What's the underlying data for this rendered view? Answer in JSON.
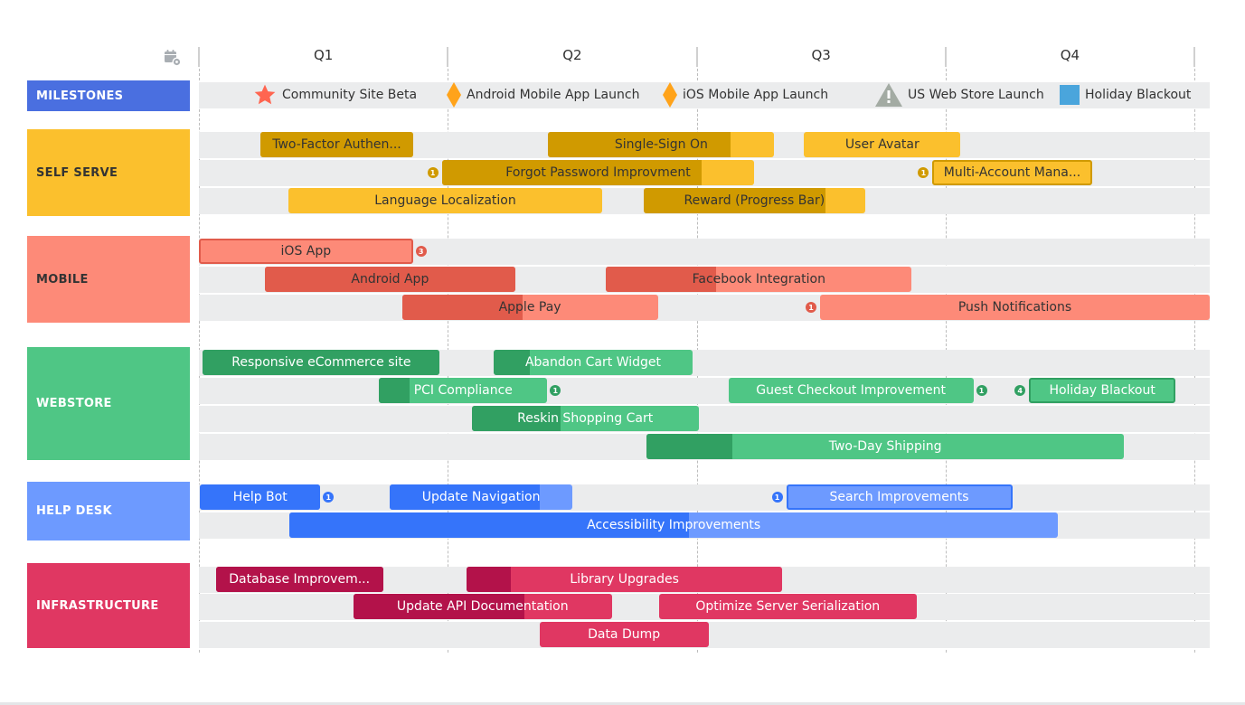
{
  "header": {
    "settings_icon": "calendar-gear-icon",
    "quarters": [
      "Q1",
      "Q2",
      "Q3",
      "Q4"
    ]
  },
  "milestones": {
    "label": "MILESTONES",
    "color": "#4a6fe0",
    "items": [
      {
        "name": "Community Site Beta",
        "icon": "star-icon",
        "color": "#ff6550",
        "position": 0.066
      },
      {
        "name": "Android Mobile App Launch",
        "icon": "diamond-icon",
        "color": "#ffa31a",
        "position": 0.25
      },
      {
        "name": "iOS Mobile App Launch",
        "icon": "diamond-icon",
        "color": "#ffa31a",
        "position": 0.477
      },
      {
        "name": "US Web Store Launch",
        "icon": "warning-icon",
        "color": "#a3aba3",
        "position": 0.68
      },
      {
        "name": "Holiday Blackout",
        "icon": "square-icon",
        "color": "#4aa5dc",
        "position": 0.864
      }
    ]
  },
  "lanes": [
    {
      "label": "SELF SERVE",
      "color": "#fbc02d",
      "dark": "#d09a00",
      "text": "#333333",
      "label_text": "#333333",
      "rows": [
        [
          {
            "name": "Two-Factor Authen...",
            "start": 0.062,
            "end": 0.215,
            "progress": 1.0
          },
          {
            "name": "Single-Sign On",
            "start": 0.351,
            "end": 0.578,
            "progress": 0.807
          },
          {
            "name": "User Avatar",
            "start": 0.608,
            "end": 0.765,
            "progress": 0.0
          }
        ],
        [
          {
            "name": "Forgot Password Improvment",
            "start": 0.244,
            "end": 0.558,
            "progress": 0.83,
            "badge_before": "1"
          },
          {
            "name": "Multi-Account Mana...",
            "start": 0.737,
            "end": 0.897,
            "progress": 0.0,
            "badge_before": "1",
            "outlined": true
          }
        ],
        [
          {
            "name": "Language Localization",
            "start": 0.09,
            "end": 0.405,
            "progress": 0.0
          },
          {
            "name": "Reward (Progress Bar)",
            "start": 0.447,
            "end": 0.669,
            "progress": 0.82
          }
        ]
      ]
    },
    {
      "label": "MOBILE",
      "color": "#fd8a78",
      "dark": "#e15b4b",
      "text": "#333333",
      "label_text": "#333333",
      "rows": [
        [
          {
            "name": "iOS App",
            "start": 0.0,
            "end": 0.215,
            "progress": 0.0,
            "badge_after": "3",
            "outlined": true
          }
        ],
        [
          {
            "name": "Android App",
            "start": 0.066,
            "end": 0.318,
            "progress": 1.0
          },
          {
            "name": "Facebook Integration",
            "start": 0.409,
            "end": 0.716,
            "progress": 0.36
          }
        ],
        [
          {
            "name": "Apple Pay",
            "start": 0.204,
            "end": 0.461,
            "progress": 0.47
          },
          {
            "name": "Push Notifications",
            "start": 0.624,
            "end": 1.016,
            "progress": 0.0,
            "badge_before": "1"
          }
        ]
      ]
    },
    {
      "label": "WEBSTORE",
      "color": "#4fc685",
      "dark": "#31a062",
      "text": "#ffffff",
      "label_text": "#ffffff",
      "rows": [
        [
          {
            "name": "Responsive eCommerce site",
            "start": 0.004,
            "end": 0.242,
            "progress": 1.0
          },
          {
            "name": "Abandon Cart Widget",
            "start": 0.296,
            "end": 0.496,
            "progress": 0.18
          }
        ],
        [
          {
            "name": "PCI Compliance",
            "start": 0.181,
            "end": 0.35,
            "progress": 0.18,
            "badge_after": "1"
          },
          {
            "name": "Guest Checkout Improvement",
            "start": 0.532,
            "end": 0.778,
            "progress": 0.0,
            "badge_after": "1"
          },
          {
            "name": "Holiday Blackout",
            "start": 0.834,
            "end": 0.981,
            "progress": 0.0,
            "badge_before": "4",
            "outlined": true
          }
        ],
        [
          {
            "name": "Reskin Shopping Cart",
            "start": 0.274,
            "end": 0.502,
            "progress": 0.39
          }
        ],
        [
          {
            "name": "Two-Day Shipping",
            "start": 0.45,
            "end": 0.929,
            "progress": 0.18
          }
        ]
      ]
    },
    {
      "label": "HELP DESK",
      "color": "#6d9aff",
      "dark": "#3574fa",
      "text": "#ffffff",
      "label_text": "#ffffff",
      "rows": [
        [
          {
            "name": "Help Bot",
            "start": 0.001,
            "end": 0.122,
            "progress": 1.0,
            "badge_after": "1"
          },
          {
            "name": "Update Navigation",
            "start": 0.192,
            "end": 0.375,
            "progress": 0.82
          },
          {
            "name": "Search Improvements",
            "start": 0.59,
            "end": 0.817,
            "progress": 0.0,
            "badge_before": "1",
            "outlined": true
          }
        ],
        [
          {
            "name": "Accessibility Improvements",
            "start": 0.091,
            "end": 0.863,
            "progress": 0.52
          }
        ]
      ]
    },
    {
      "label": "INFRASTRUCTURE",
      "color": "#e03762",
      "dark": "#b3124a",
      "text": "#ffffff",
      "label_text": "#ffffff",
      "rows": [
        [
          {
            "name": "Database Improvem...",
            "start": 0.017,
            "end": 0.185,
            "progress": 1.0
          },
          {
            "name": "Library Upgrades",
            "start": 0.269,
            "end": 0.586,
            "progress": 0.14
          }
        ],
        [
          {
            "name": "Update API Documentation",
            "start": 0.155,
            "end": 0.415,
            "progress": 0.66
          },
          {
            "name": "Optimize Server Serialization",
            "start": 0.462,
            "end": 0.721,
            "progress": 0.0
          }
        ],
        [
          {
            "name": "Data Dump",
            "start": 0.342,
            "end": 0.512,
            "progress": 0.0
          }
        ]
      ]
    }
  ]
}
